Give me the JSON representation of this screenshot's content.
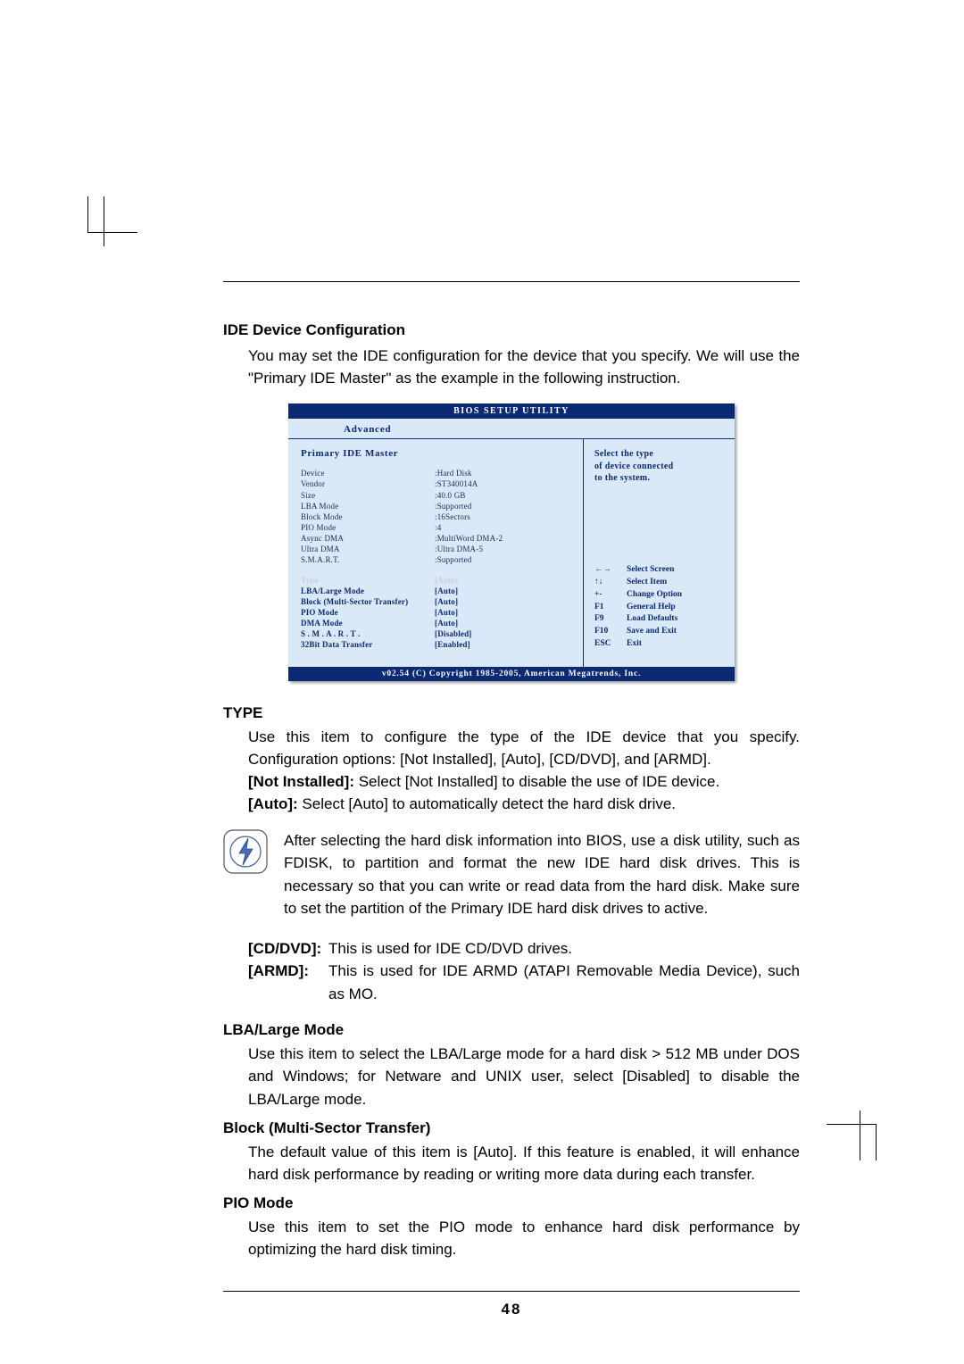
{
  "heading_ide": "IDE Device Configuration",
  "ide_intro": "You may set the IDE configuration for the device that you specify. We will use the \"Primary IDE Master\" as the example in the following instruction.",
  "bios": {
    "title": "BIOS SETUP UTILITY",
    "tab": "Advanced",
    "screen_heading": "Primary IDE Master",
    "info_rows": [
      {
        "label": "Device",
        "value": ":Hard Disk"
      },
      {
        "label": "Vendor",
        "value": ":ST340014A"
      },
      {
        "label": "Size",
        "value": ":40.0 GB"
      },
      {
        "label": "LBA Mode",
        "value": ":Supported"
      },
      {
        "label": "Block Mode",
        "value": ":16Sectors"
      },
      {
        "label": "PIO Mode",
        "value": ":4"
      },
      {
        "label": "Async DMA",
        "value": ":MultiWord DMA-2"
      },
      {
        "label": "Ultra DMA",
        "value": ":Ultra DMA-5"
      },
      {
        "label": "S.M.A.R.T.",
        "value": ":Supported"
      }
    ],
    "selected": {
      "label": "Type",
      "value": "[Auto]"
    },
    "option_rows": [
      {
        "label": "LBA/Large Mode",
        "value": "[Auto]"
      },
      {
        "label": "Block (Multi-Sector Transfer)",
        "value": "[Auto]"
      },
      {
        "label": "PIO Mode",
        "value": "[Auto]"
      },
      {
        "label": "DMA Mode",
        "value": "[Auto]"
      },
      {
        "label": "S . M . A . R . T .",
        "value": "[Disabled]"
      },
      {
        "label": "32Bit Data Transfer",
        "value": "[Enabled]"
      }
    ],
    "help_text_1": "Select the type",
    "help_text_2": "of device connected",
    "help_text_3": "to the system.",
    "keys": [
      {
        "k": "←→",
        "d": "Select Screen"
      },
      {
        "k": "↑↓",
        "d": "Select Item"
      },
      {
        "k": "+-",
        "d": "Change Option"
      },
      {
        "k": "F1",
        "d": "General Help"
      },
      {
        "k": "F9",
        "d": "Load Defaults"
      },
      {
        "k": "F10",
        "d": "Save and Exit"
      },
      {
        "k": "ESC",
        "d": "Exit"
      }
    ],
    "footer": "v02.54 (C) Copyright 1985-2005, American Megatrends, Inc."
  },
  "type_heading": "TYPE",
  "type_para1": "Use this item to configure the type of the IDE device that you specify. Configuration options: [Not Installed], [Auto], [CD/DVD], and [ARMD].",
  "type_notinstalled_label": "[Not Installed]:",
  "type_notinstalled_text": " Select [Not Installed] to disable the use of IDE device.",
  "type_auto_label": "[Auto]:",
  "type_auto_text": " Select [Auto] to automatically detect the hard disk drive.",
  "note_text": "After selecting the hard disk information into BIOS, use a disk utility, such as FDISK, to partition and format the new IDE hard disk drives. This is necessary so that you can write or read data from the hard disk. Make sure to set the partition of the Primary IDE hard disk drives to active.",
  "cddvd_label": "[CD/DVD]:",
  "cddvd_text": "This is used for IDE CD/DVD drives.",
  "armd_label": "[ARMD]:",
  "armd_text": "This is used for IDE ARMD (ATAPI Removable Media Device), such as MO.",
  "lba_heading": "LBA/Large Mode",
  "lba_text": "Use this item to select the LBA/Large mode for a hard disk > 512 MB under DOS and Windows; for Netware and UNIX user, select [Disabled] to disable the LBA/Large mode.",
  "block_heading": "Block (Multi-Sector Transfer)",
  "block_text": "The default value of this item is [Auto]. If this feature is enabled, it will enhance hard disk performance by reading or writing more data during each transfer.",
  "pio_heading": "PIO Mode",
  "pio_text": "Use this item to set the PIO mode to enhance hard disk performance by optimizing the hard disk timing.",
  "page_number": "48"
}
